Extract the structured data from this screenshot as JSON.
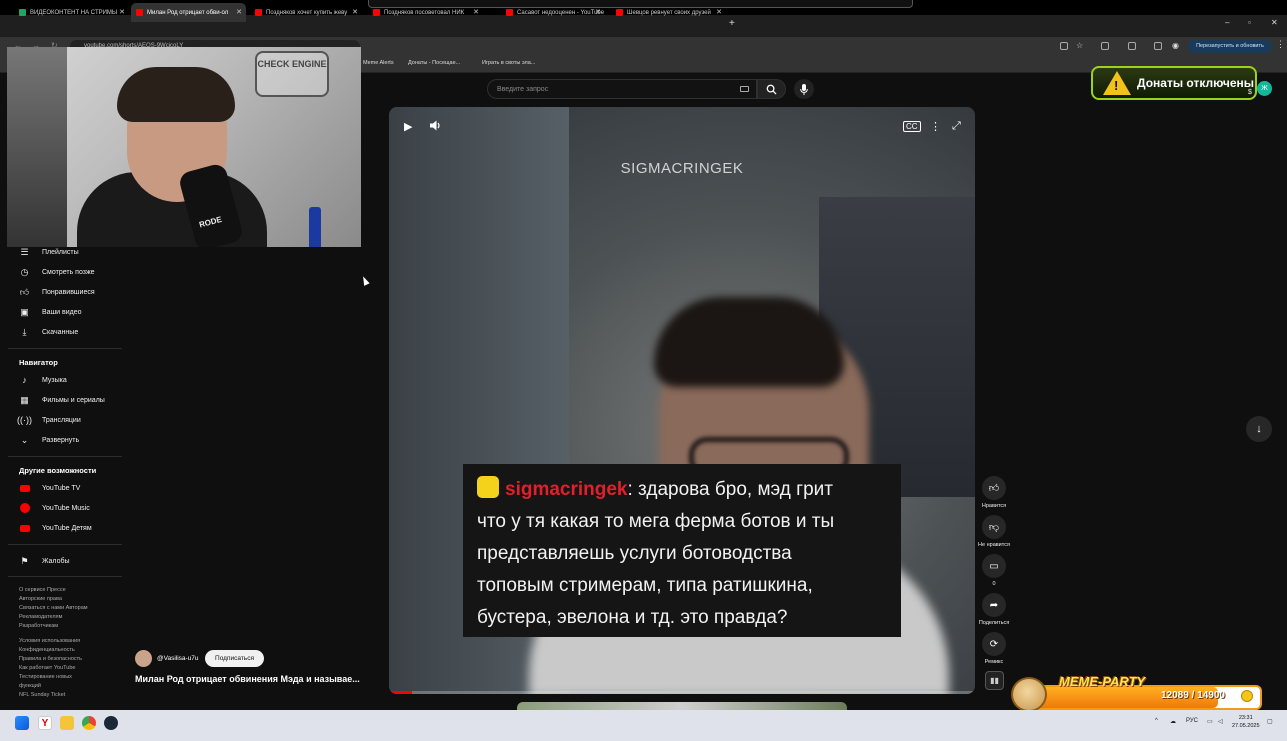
{
  "browser": {
    "tabs": [
      {
        "label": "ВИДЕОКОНТЕНТ НА СТРИМЫ",
        "favicon_color": "#1fa463"
      },
      {
        "label": "Милан Род отрицает обви-ол",
        "favicon_color": "#ff0000",
        "active": true
      },
      {
        "label": "Поздняков хочет купить жеву",
        "favicon_color": "#ff0000"
      },
      {
        "label": "Поздняков посоветовал НИК",
        "favicon_color": "#ff0000"
      },
      {
        "label": "Сасавот недооценен - YouTube",
        "favicon_color": "#ff0000"
      },
      {
        "label": "Шевцов ревнует своих друзей",
        "favicon_color": "#ff0000"
      }
    ],
    "new_tab": "+",
    "window_controls": {
      "minimize": "–",
      "maximize": "▫",
      "close": "✕"
    },
    "url": "youtube.com/shorts/AEQS-9WcicoLY",
    "restart_button": "Перезапустить и обновить",
    "bookmarks": [
      "Meme Alerts",
      "Донаты - Посещае...",
      "Играть в своты эла..."
    ]
  },
  "youtube": {
    "search_placeholder": "Введите запрос",
    "sidebar": {
      "you_items": [
        {
          "label": "Плейлисты",
          "icon": "playlist-icon"
        },
        {
          "label": "Смотреть позже",
          "icon": "clock-icon"
        },
        {
          "label": "Понравившиеся",
          "icon": "thumbs-up-icon"
        },
        {
          "label": "Ваши видео",
          "icon": "video-icon"
        },
        {
          "label": "Скачанные",
          "icon": "download-icon"
        }
      ],
      "navigator_heading": "Навигатор",
      "navigator_items": [
        {
          "label": "Музыка",
          "icon": "music-icon"
        },
        {
          "label": "Фильмы и сериалы",
          "icon": "film-icon"
        },
        {
          "label": "Трансляции",
          "icon": "live-icon"
        },
        {
          "label": "Развернуть",
          "icon": "chevron-down-icon"
        }
      ],
      "more_heading": "Другие возможности",
      "more_items": [
        {
          "label": "YouTube TV"
        },
        {
          "label": "YouTube Music"
        },
        {
          "label": "YouTube Детям"
        }
      ],
      "report_label": "Жалобы",
      "footer_1": [
        "О сервисе  Прессе",
        "Авторские права",
        "Связаться с нами  Авторам",
        "Рекламодателям",
        "Разработчикам"
      ],
      "footer_2": [
        "Условия использования",
        "Конфиденциальность",
        "Правила и безопасность",
        "Как работает YouTube",
        "Тестирование новых",
        "функций",
        "NFL Sunday Ticket"
      ]
    },
    "video": {
      "watermark": "SIGMACRINGEK",
      "chat_nick": "sigmacringek",
      "chat_lines": [
        ": здарова бро, мэд грит",
        "что у тя какая то мега ферма ботов и ты",
        "представляешь услуги ботоводства",
        "топовым стримерам, типа ратишкина,",
        "бустера, эвелона и тд. это правда?"
      ],
      "progress_fraction": 0.04
    },
    "actions": {
      "like": "Нравится",
      "dislike": "Не нравится",
      "comments": "0",
      "share": "Поделиться",
      "remix": "Ремикс"
    },
    "channel": {
      "name": "@Vasilisa-u7u",
      "subscribe": "Подписаться",
      "title": "Милан Род отрицает обвинения Мэда и называе..."
    }
  },
  "overlays": {
    "webcam_sign": "CHECK ENGINE",
    "mic_label": "RODE",
    "donate_text": "Донаты отключены",
    "donate_badge": "Ж",
    "donate_dollar": "$",
    "meme_title": "MEME-PARTY",
    "meme_count": "12089 / 14900",
    "meme_progress": 0.81
  },
  "taskbar": {
    "tray_lang": "РУС",
    "time": "23:31",
    "date": "27.05.2025"
  }
}
